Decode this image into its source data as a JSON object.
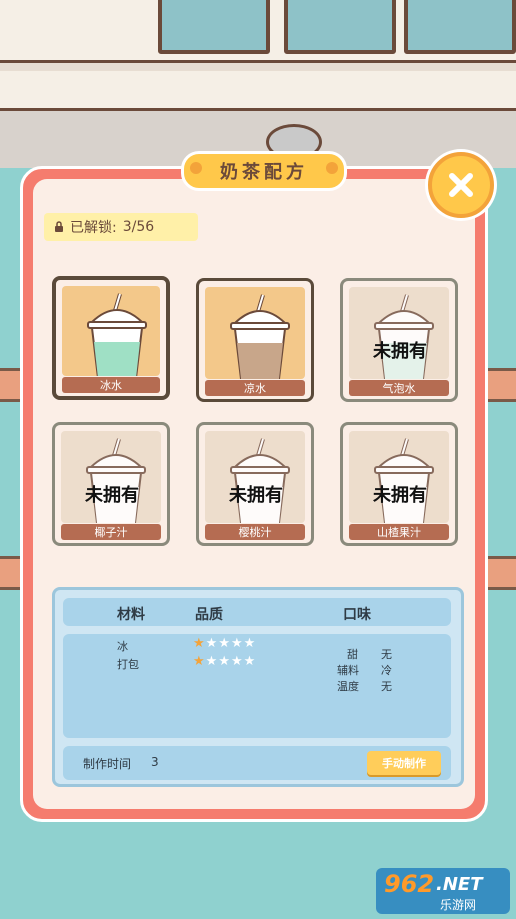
{
  "panel": {
    "title": "奶茶配方",
    "unlocked_label": "已解锁:",
    "unlocked_value": "3/56"
  },
  "recipes": [
    {
      "name": "冰水",
      "owned": true,
      "selected": true,
      "liquid": "#9fe0c5"
    },
    {
      "name": "凉水",
      "owned": true,
      "selected": false,
      "liquid": "#c8a68a"
    },
    {
      "name": "气泡水",
      "owned": false,
      "selected": false,
      "liquid": "#dff4ec"
    },
    {
      "name": "椰子汁",
      "owned": false,
      "selected": false,
      "liquid": "#ffffff"
    },
    {
      "name": "樱桃汁",
      "owned": false,
      "selected": false,
      "liquid": "#ffffff"
    },
    {
      "name": "山楂果汁",
      "owned": false,
      "selected": false,
      "liquid": "#ffffff"
    }
  ],
  "locked_label": "未拥有",
  "details": {
    "headers": {
      "ingredients": "材料",
      "quality": "品质",
      "taste": "口味"
    },
    "ingredients": [
      {
        "name": "冰",
        "stars": 0.5
      },
      {
        "name": "打包",
        "stars": 0.5
      }
    ],
    "taste": [
      {
        "label": "甜",
        "value": "无"
      },
      {
        "label": "辅料",
        "value": "冷"
      },
      {
        "label": "温度",
        "value": "无"
      }
    ],
    "time_label": "制作时间",
    "time_value": "3",
    "make_button": "手动制作"
  },
  "watermark": {
    "brand": "962",
    "suffix": ".NET",
    "sub": "乐游网"
  },
  "colors": {
    "panel": "#f57c6e",
    "accent": "#ffc84a",
    "locked_border": "#8a8a7c",
    "selected_border": "#9a7ce0"
  }
}
